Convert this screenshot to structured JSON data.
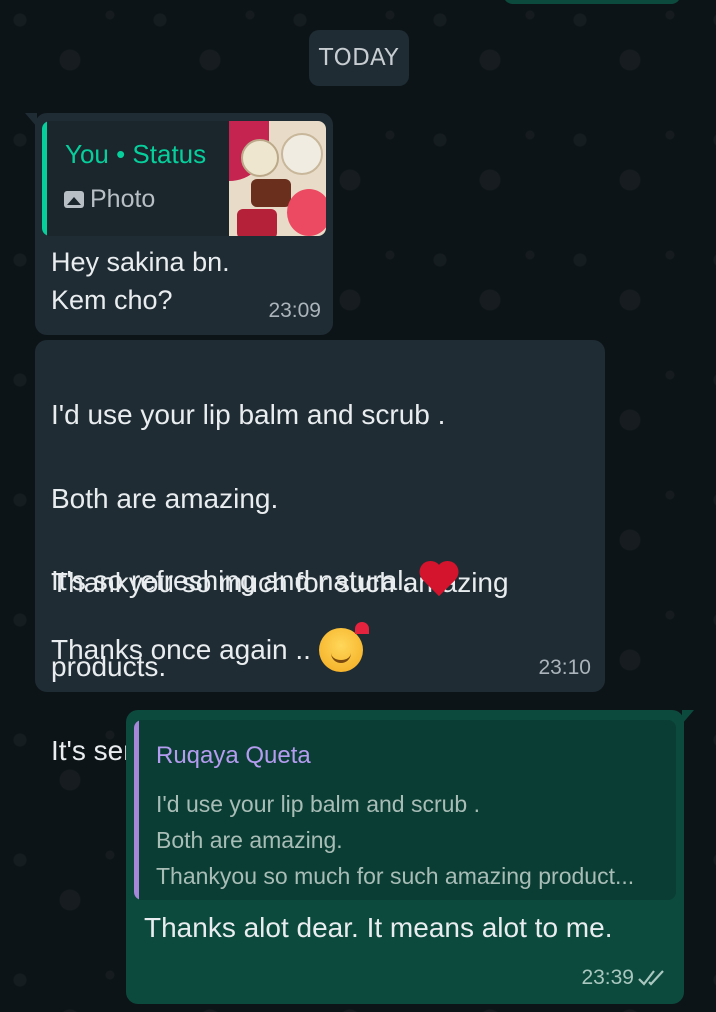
{
  "date_chip": "TODAY",
  "messages": [
    {
      "direction": "incoming",
      "status_reply": {
        "author": "You • Status",
        "label": "Photo",
        "thumbnail": "status-photo-thumbnail"
      },
      "text": "Hey sakina bn.\nKem cho?",
      "time": "23:09"
    },
    {
      "direction": "incoming",
      "lines": [
        "I'd use your lip balm and scrub .",
        "Both are amazing.",
        "Thankyou so much for such amazing",
        "products.",
        "It's seriously worth buying."
      ],
      "line6": "It's so refreshing and natural.",
      "line7": "Thanks once again ..",
      "time": "23:10"
    },
    {
      "direction": "outgoing",
      "quoted": {
        "author": "Ruqaya Queta",
        "text": "I'd use your lip balm and scrub .\nBoth are amazing.\nThankyou so much for such amazing product..."
      },
      "text": "Thanks alot dear. It means alot to me.",
      "time": "23:39",
      "status_icon": "double-check-icon"
    }
  ],
  "colors": {
    "incoming_bubble": "#1f2c34",
    "outgoing_bubble": "#0c4a3e",
    "status_author": "#06cf9c",
    "quoted_author": "#b59cf0"
  }
}
